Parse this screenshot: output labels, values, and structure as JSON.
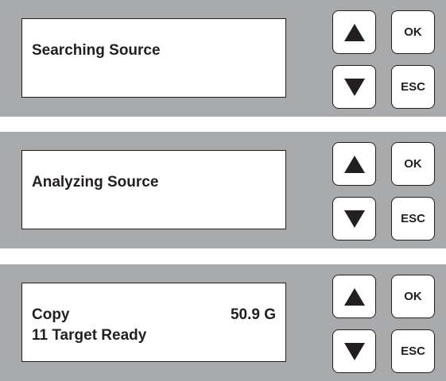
{
  "panels": [
    {
      "display": {
        "line1": "Searching Source",
        "line2": "",
        "right": ""
      },
      "buttons": {
        "up_icon": "up-arrow-icon",
        "down_icon": "down-arrow-icon",
        "ok_label": "OK",
        "esc_label": "ESC"
      }
    },
    {
      "display": {
        "line1": "Analyzing Source",
        "line2": "",
        "right": ""
      },
      "buttons": {
        "up_icon": "up-arrow-icon",
        "down_icon": "down-arrow-icon",
        "ok_label": "OK",
        "esc_label": "ESC"
      }
    },
    {
      "display": {
        "line1": "Copy",
        "line2": "11 Target Ready",
        "right": "50.9 G"
      },
      "buttons": {
        "up_icon": "up-arrow-icon",
        "down_icon": "down-arrow-icon",
        "ok_label": "OK",
        "esc_label": "ESC"
      }
    }
  ],
  "colors": {
    "panel_background": "#a9aaac",
    "display_background": "#ffffff",
    "text": "#231f20"
  }
}
